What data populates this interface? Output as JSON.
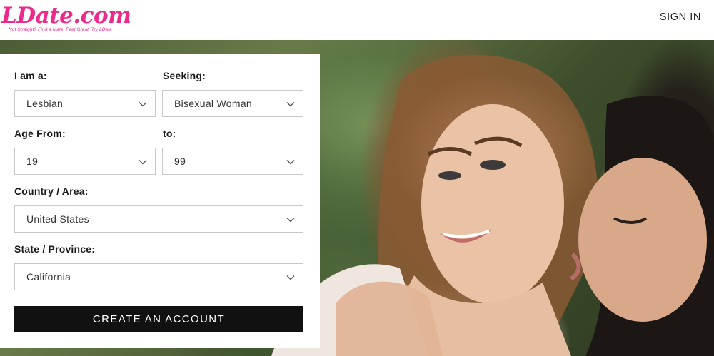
{
  "brand": {
    "logo_text": "LDate.com",
    "tagline": "Not Straight? Find a Mate. Feel Great. Try LDate",
    "brand_color": "#ec2a8c"
  },
  "header": {
    "signin_label": "SIGN IN"
  },
  "form": {
    "i_am_label": "I am a:",
    "i_am_value": "Lesbian",
    "seeking_label": "Seeking:",
    "seeking_value": "Bisexual Woman",
    "age_from_label": "Age From:",
    "age_from_value": "19",
    "age_to_label": "to:",
    "age_to_value": "99",
    "country_label": "Country / Area:",
    "country_value": "United States",
    "state_label": "State / Province:",
    "state_value": "California",
    "submit_label": "CREATE AN ACCOUNT"
  },
  "icons": {
    "dropdown": "chevron-down-icon"
  }
}
